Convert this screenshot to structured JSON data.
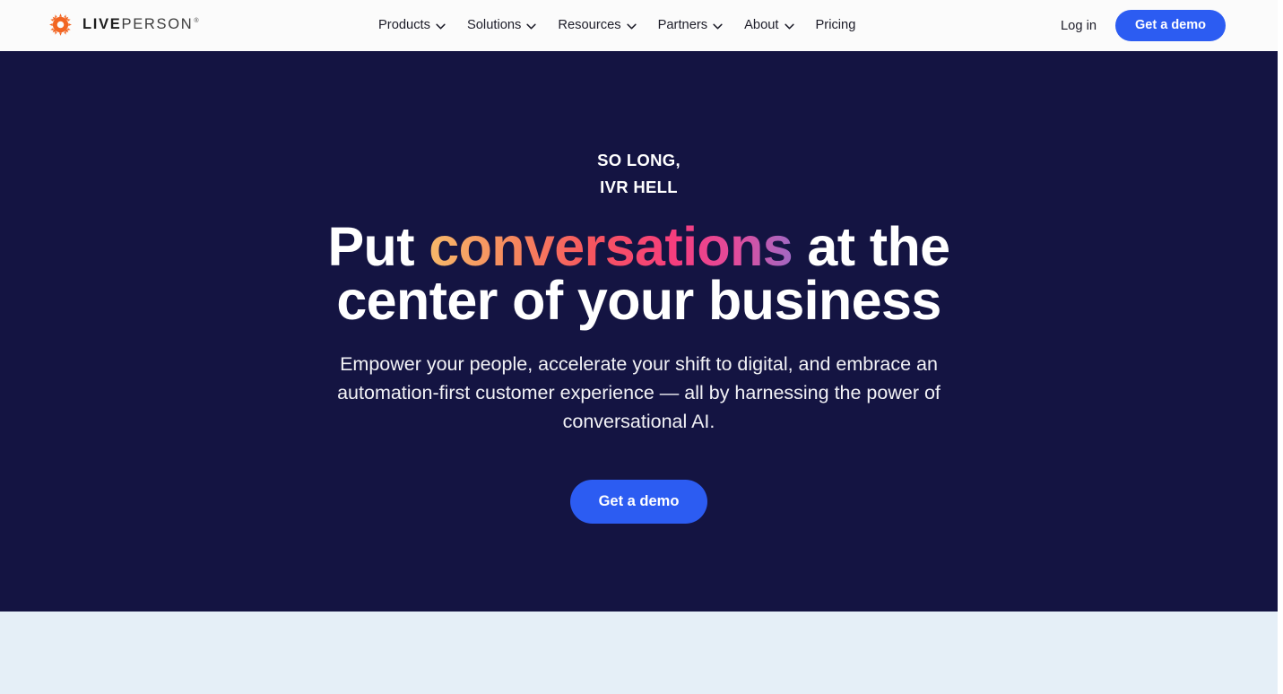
{
  "brand": {
    "logo_icon": "gear-sun-icon",
    "name_bold": "LIVE",
    "name_light": "PERSON",
    "trademark": "®",
    "logo_color": "#F26522"
  },
  "header": {
    "background": "#FBFBFB",
    "nav_items": [
      {
        "label": "Products",
        "has_dropdown": true,
        "icon": "chevron-down-icon"
      },
      {
        "label": "Solutions",
        "has_dropdown": true,
        "icon": "chevron-down-icon"
      },
      {
        "label": "Resources",
        "has_dropdown": true,
        "icon": "chevron-down-icon"
      },
      {
        "label": "Partners",
        "has_dropdown": true,
        "icon": "chevron-down-icon"
      },
      {
        "label": "About",
        "has_dropdown": true,
        "icon": "chevron-down-icon"
      },
      {
        "label": "Pricing",
        "has_dropdown": false,
        "icon": ""
      }
    ],
    "login_label": "Log in",
    "cta_label": "Get a demo",
    "cta_color": "#2C5CF2"
  },
  "hero": {
    "background": "#141442",
    "eyebrow_line1": "SO LONG,",
    "eyebrow_line2": "IVR HELL",
    "headline_pre": "Put ",
    "headline_gradient_word": "conversations",
    "headline_post": " at the center of your business",
    "gradient_colors": [
      "#F7B96A",
      "#F58A5E",
      "#F7555F",
      "#F53D7E",
      "#E34B9B",
      "#A169C4"
    ],
    "subtitle": "Empower your people, accelerate your shift to digital, and embrace an automation-first customer experience — all by harnessing the power of conversational AI.",
    "cta_label": "Get a demo",
    "cta_color": "#2C5CF2"
  },
  "next_section": {
    "background": "#E5EFF7"
  }
}
